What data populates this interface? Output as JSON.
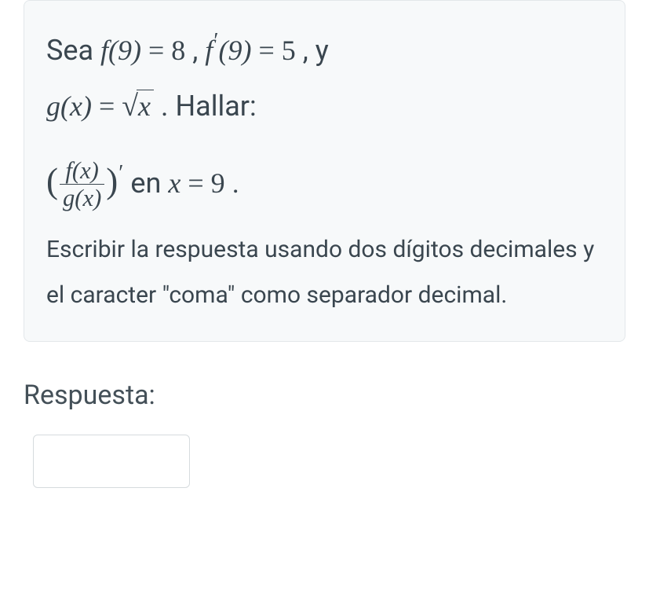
{
  "problem": {
    "lead": "Sea ",
    "f9_lhs": "f(9)",
    "eq": "=",
    "f9_val": "8",
    "comma1": ", ",
    "fp9_lhs_f": "f",
    "fp9_prime": "′",
    "fp9_arg": "(9)",
    "fp9_val": "5",
    "comma2": ", y",
    "g_lhs_g": "g",
    "g_lhs_arg": "(x)",
    "sqrt_arg": "x",
    "hallar": ". Hallar:",
    "frac_num_f": "f",
    "frac_num_arg": "(x)",
    "frac_den_g": "g",
    "frac_den_arg": "(x)",
    "deriv_prime": "′",
    "en": " en ",
    "at_var": "x",
    "at_val": "9",
    "period": ".",
    "instruction": "Escribir la respuesta usando dos dígitos decimales y el caracter \"coma\" como separador decimal."
  },
  "answer": {
    "label": "Respuesta:",
    "value": ""
  }
}
